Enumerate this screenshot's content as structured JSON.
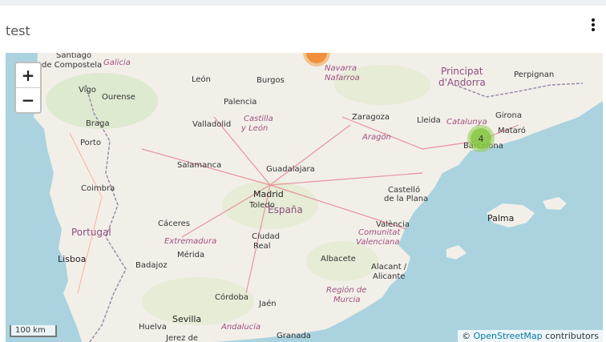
{
  "card": {
    "title": "test"
  },
  "map": {
    "labels": [
      {
        "text": "Santiago",
        "cls": "city"
      },
      {
        "text": "de Compostela",
        "cls": "city"
      },
      {
        "text": "Galicia",
        "cls": "region"
      },
      {
        "text": "León",
        "cls": "city"
      },
      {
        "text": "Burgos",
        "cls": "city"
      },
      {
        "text": "Navarra",
        "cls": "region"
      },
      {
        "text": "Nafarroa",
        "cls": "region"
      },
      {
        "text": "Principat",
        "cls": "country"
      },
      {
        "text": "d'Andorra",
        "cls": "country"
      },
      {
        "text": "Perpignan",
        "cls": "city"
      },
      {
        "text": "Vigo",
        "cls": "city"
      },
      {
        "text": "Ourense",
        "cls": "city"
      },
      {
        "text": "Palencia",
        "cls": "city"
      },
      {
        "text": "Zaragoza",
        "cls": "city"
      },
      {
        "text": "Castilla",
        "cls": "region"
      },
      {
        "text": "y León",
        "cls": "region"
      },
      {
        "text": "Braga",
        "cls": "city"
      },
      {
        "text": "Valladolid",
        "cls": "city"
      },
      {
        "text": "Lleida",
        "cls": "city"
      },
      {
        "text": "Catalunya",
        "cls": "region"
      },
      {
        "text": "Girona",
        "cls": "city"
      },
      {
        "text": "Aragón",
        "cls": "region"
      },
      {
        "text": "Mataró",
        "cls": "city"
      },
      {
        "text": "Porto",
        "cls": "city"
      },
      {
        "text": "Barcelona",
        "cls": "city"
      },
      {
        "text": "Salamanca",
        "cls": "city"
      },
      {
        "text": "Guadalajara",
        "cls": "city"
      },
      {
        "text": "Coimbra",
        "cls": "city"
      },
      {
        "text": "Madrid",
        "cls": "cap"
      },
      {
        "text": "Castelló",
        "cls": "city"
      },
      {
        "text": "de la Plana",
        "cls": "city"
      },
      {
        "text": "Toledo",
        "cls": "city"
      },
      {
        "text": "España",
        "cls": "country"
      },
      {
        "text": "Palma",
        "cls": "cap"
      },
      {
        "text": "Cáceres",
        "cls": "city"
      },
      {
        "text": "València",
        "cls": "city"
      },
      {
        "text": "Comunitat",
        "cls": "region"
      },
      {
        "text": "Portugal",
        "cls": "country"
      },
      {
        "text": "Ciudad",
        "cls": "city"
      },
      {
        "text": "Real",
        "cls": "city"
      },
      {
        "text": "Valenciana",
        "cls": "region"
      },
      {
        "text": "Extremadura",
        "cls": "region"
      },
      {
        "text": "Lisboa",
        "cls": "cap"
      },
      {
        "text": "Mérida",
        "cls": "city"
      },
      {
        "text": "Albacete",
        "cls": "city"
      },
      {
        "text": "Badajoz",
        "cls": "city"
      },
      {
        "text": "Alacant /",
        "cls": "city"
      },
      {
        "text": "Alicante",
        "cls": "city"
      },
      {
        "text": "Región de",
        "cls": "region"
      },
      {
        "text": "Córdoba",
        "cls": "city"
      },
      {
        "text": "Jaén",
        "cls": "city"
      },
      {
        "text": "Murcia",
        "cls": "region"
      },
      {
        "text": "Sevilla",
        "cls": "cap"
      },
      {
        "text": "Huelva",
        "cls": "city"
      },
      {
        "text": "Andalucía",
        "cls": "region"
      },
      {
        "text": "Granada",
        "cls": "city"
      },
      {
        "text": "Jerez de",
        "cls": "city"
      }
    ],
    "markers": [
      {
        "count": "4",
        "color": "green"
      },
      {
        "count": "",
        "color": "orange"
      }
    ],
    "zoom_in": "+",
    "zoom_out": "−",
    "scale": "100 km",
    "attribution_prefix": "© ",
    "attribution_link": "OpenStreetMap",
    "attribution_suffix": " contributors"
  }
}
